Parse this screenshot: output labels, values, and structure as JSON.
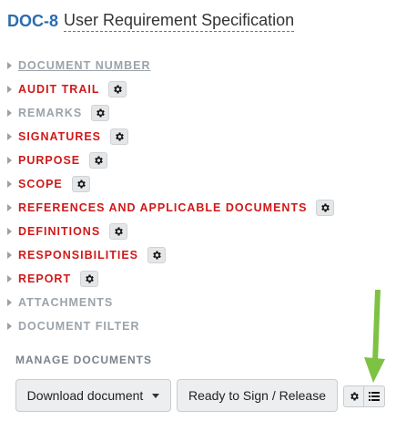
{
  "header": {
    "doc_id": "DOC-8",
    "doc_title": "User Requirement Specification"
  },
  "sections": [
    {
      "label": "DOCUMENT NUMBER",
      "style": "grey-underlined",
      "has_gear": false
    },
    {
      "label": "AUDIT TRAIL",
      "style": "red",
      "has_gear": true
    },
    {
      "label": "REMARKS",
      "style": "grey",
      "has_gear": true
    },
    {
      "label": "SIGNATURES",
      "style": "red",
      "has_gear": true
    },
    {
      "label": "PURPOSE",
      "style": "red",
      "has_gear": true
    },
    {
      "label": "SCOPE",
      "style": "red",
      "has_gear": true
    },
    {
      "label": "REFERENCES AND APPLICABLE DOCUMENTS",
      "style": "red",
      "has_gear": true
    },
    {
      "label": "DEFINITIONS",
      "style": "red",
      "has_gear": true
    },
    {
      "label": "RESPONSIBILITIES",
      "style": "red",
      "has_gear": true
    },
    {
      "label": "REPORT",
      "style": "red",
      "has_gear": true
    },
    {
      "label": "ATTACHMENTS",
      "style": "grey",
      "has_gear": false
    },
    {
      "label": "DOCUMENT FILTER",
      "style": "grey",
      "has_gear": false
    }
  ],
  "manage": {
    "title": "MANAGE DOCUMENTS",
    "download_label": "Download document",
    "sign_release_label": "Ready to Sign / Release",
    "settings_icon": "gear-icon",
    "list_icon": "list-icon"
  },
  "colors": {
    "doc_id": "#2b6cb0",
    "red_section": "#d01919",
    "grey_section": "#9ba3aa",
    "arrow": "#7dc242"
  }
}
